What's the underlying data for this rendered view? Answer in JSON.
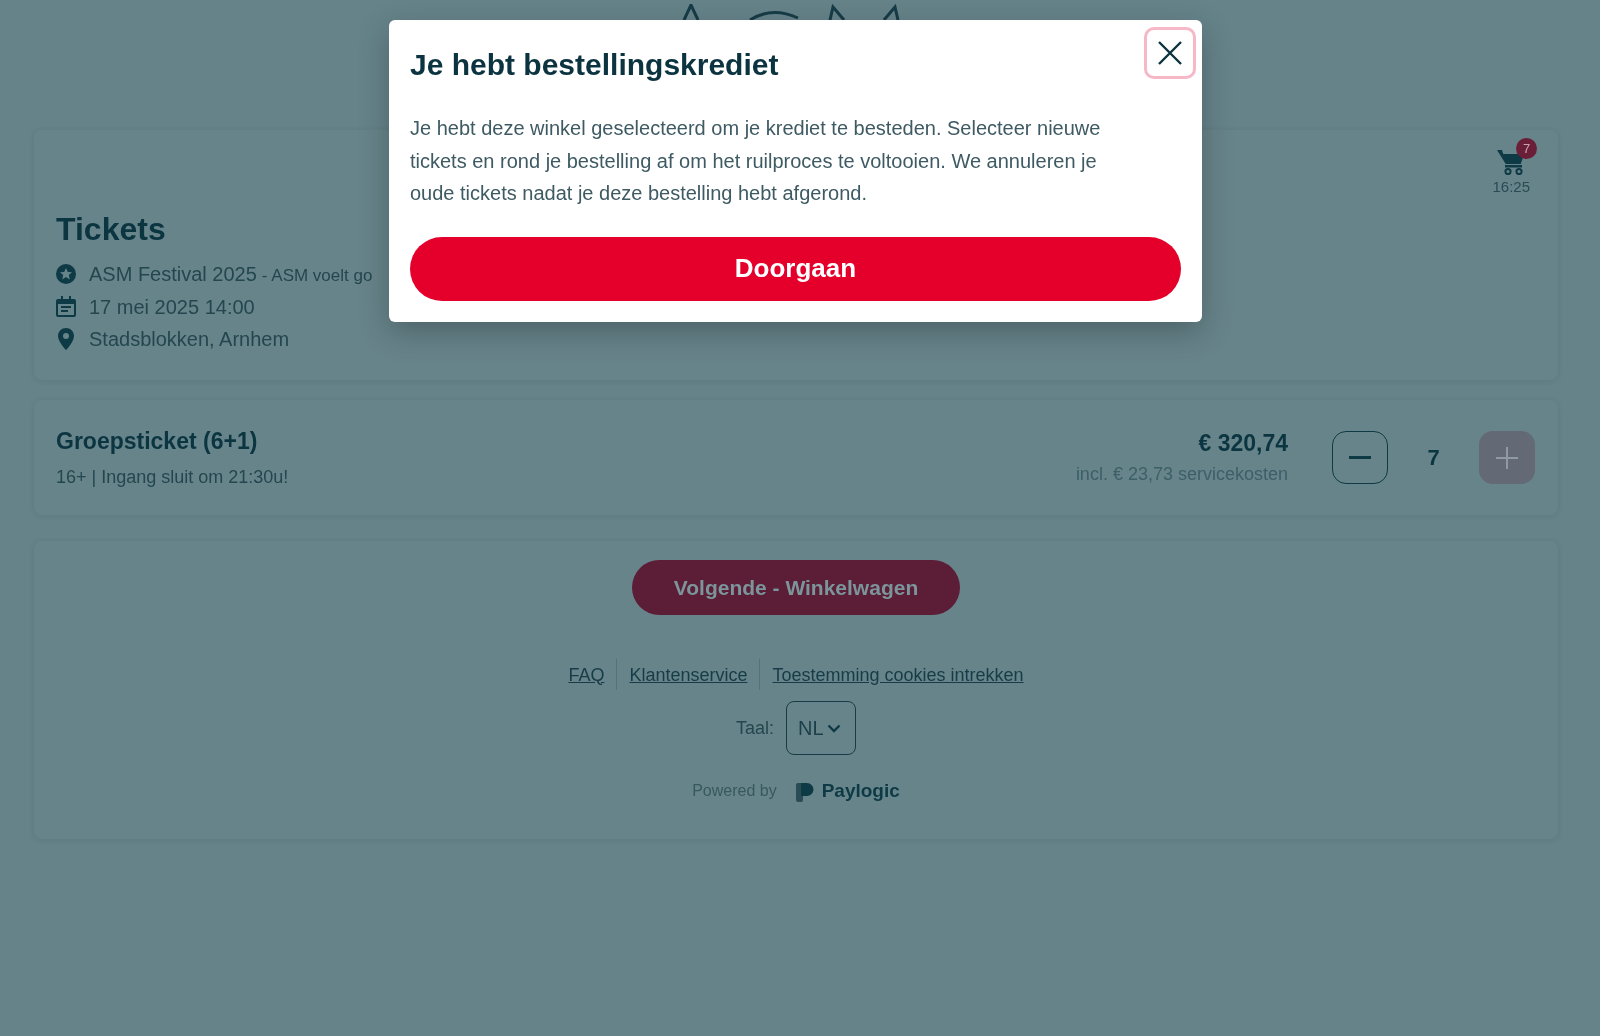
{
  "event_card": {
    "heading": "Tickets",
    "details": [
      {
        "kind": "event",
        "text": "ASM Festival 2025",
        "subtitle": "- ASM voelt go"
      },
      {
        "kind": "date",
        "text": "17 mei 2025 14:00"
      },
      {
        "kind": "location",
        "text": "Stadsblokken, Arnhem"
      }
    ],
    "cart": {
      "count": "7",
      "timer": "16:25"
    }
  },
  "ticket": {
    "name": "Groepsticket (6+1)",
    "description": "16+ | Ingang sluit om 21:30u!",
    "price": "€ 320,74",
    "fee_note": "incl. € 23,73 servicekosten",
    "quantity": "7",
    "controls": [
      {
        "kind": "decrease",
        "disabled": false
      },
      {
        "kind": "increase",
        "disabled": true
      }
    ]
  },
  "footer": {
    "next_button": "Volgende - Winkelwagen",
    "links": [
      "FAQ",
      "Klantenservice",
      "Toestemming cookies intrekken"
    ],
    "language": {
      "label": "Taal:",
      "value": "NL"
    },
    "powered_by": "Powered by",
    "brand": "Paylogic"
  },
  "modal": {
    "title": "Je hebt bestellingskrediet",
    "body": "Je hebt deze winkel geselecteerd om je krediet te besteden. Selecteer nieuwe tickets en rond je bestelling af om het ruilproces te voltooien. We annuleren je oude tickets nadat je deze bestelling hebt afgerond.",
    "close_button": {
      "focused": true
    },
    "primary_button": "Doorgaan"
  }
}
